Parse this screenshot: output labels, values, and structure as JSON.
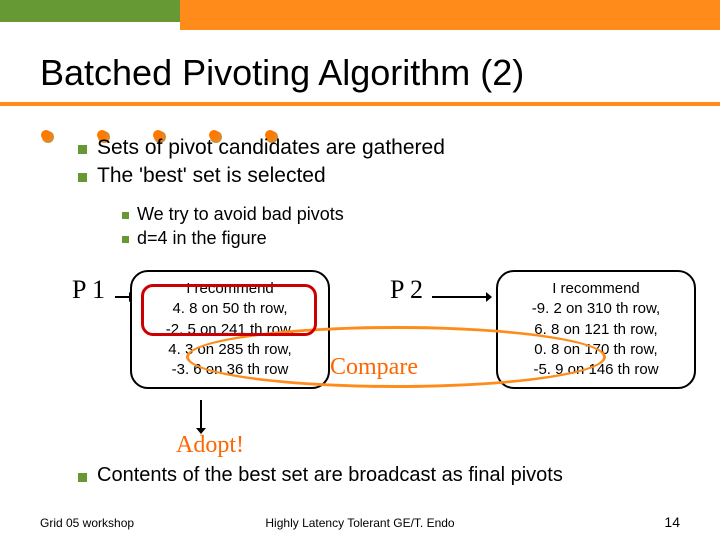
{
  "title": "Batched Pivoting Algorithm (2)",
  "bullets": {
    "l1": [
      "Sets of pivot candidates are gathered",
      "The 'best' set is selected"
    ],
    "l2": [
      "We try to avoid bad pivots",
      "d=4 in the figure"
    ],
    "final": "Contents of the best set are broadcast as final pivots"
  },
  "processes": {
    "p1": {
      "label": "P 1",
      "text": "I recommend\n4. 8 on 50 th row,\n-2. 5 on 241 th row,\n4. 3 on 285 th row,\n-3. 6 on 36 th row"
    },
    "p2": {
      "label": "P 2",
      "text": "I recommend\n-9. 2 on 310 th row,\n6. 8 on 121 th row,\n0. 8 on 170 th row,\n-5. 9 on 146 th row"
    }
  },
  "annotations": {
    "compare": "Compare",
    "adopt": "Adopt!"
  },
  "footer": {
    "left": "Grid 05 workshop",
    "center": "Highly Latency Tolerant GE/T. Endo",
    "page": "14"
  }
}
